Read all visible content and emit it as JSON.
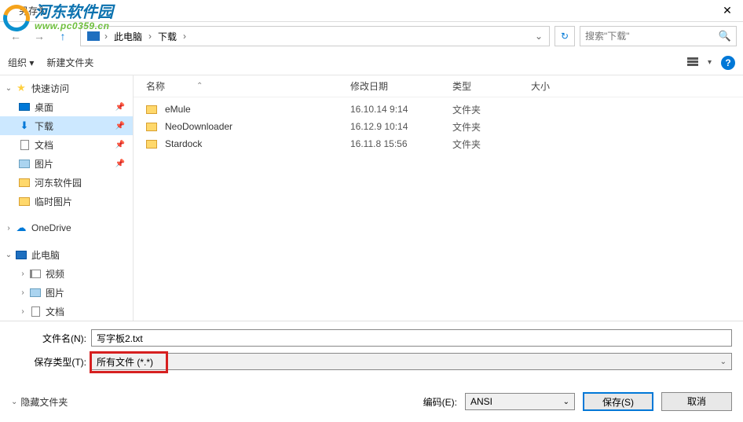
{
  "window": {
    "title": "另存为",
    "close_glyph": "✕"
  },
  "nav": {
    "back_glyph": "←",
    "forward_glyph": "→",
    "up_glyph": "↑",
    "refresh_glyph": "↻"
  },
  "breadcrumb": {
    "loc1": "此电脑",
    "loc2": "下载",
    "sep": "›",
    "drop": "⌄"
  },
  "search": {
    "placeholder": "搜索\"下载\""
  },
  "toolbar": {
    "organize": "组织 ▾",
    "new_folder": "新建文件夹",
    "help_glyph": "?"
  },
  "sidebar": {
    "quick_access": "快速访问",
    "items1": [
      {
        "label": "桌面",
        "icon": "desktop"
      },
      {
        "label": "下载",
        "icon": "download",
        "selected": true
      },
      {
        "label": "文档",
        "icon": "doc"
      },
      {
        "label": "图片",
        "icon": "pic"
      },
      {
        "label": "河东软件园",
        "icon": "folder"
      },
      {
        "label": "临时图片",
        "icon": "folder"
      }
    ],
    "onedrive": "OneDrive",
    "this_pc": "此电脑",
    "items2": [
      {
        "label": "视频",
        "icon": "vid"
      },
      {
        "label": "图片",
        "icon": "pic"
      },
      {
        "label": "文档",
        "icon": "doc"
      }
    ]
  },
  "columns": {
    "name": "名称",
    "date": "修改日期",
    "type": "类型",
    "size": "大小",
    "sort_glyph": "⌃"
  },
  "files": [
    {
      "name": "eMule",
      "date": "16.10.14 9:14",
      "type": "文件夹"
    },
    {
      "name": "NeoDownloader",
      "date": "16.12.9 10:14",
      "type": "文件夹"
    },
    {
      "name": "Stardock",
      "date": "16.11.8 15:56",
      "type": "文件夹"
    }
  ],
  "filename": {
    "label": "文件名(N):",
    "value": "写字板2.txt"
  },
  "filetype": {
    "label": "保存类型(T):",
    "value": "所有文件 (*.*)"
  },
  "footer": {
    "hide_folders": "隐藏文件夹",
    "encoding_label": "编码(E):",
    "encoding_value": "ANSI",
    "save": "保存(S)",
    "cancel": "取消",
    "chev": "⌄"
  },
  "logo": {
    "line1": "河东软件园",
    "line2": "www.pc0359.cn"
  }
}
